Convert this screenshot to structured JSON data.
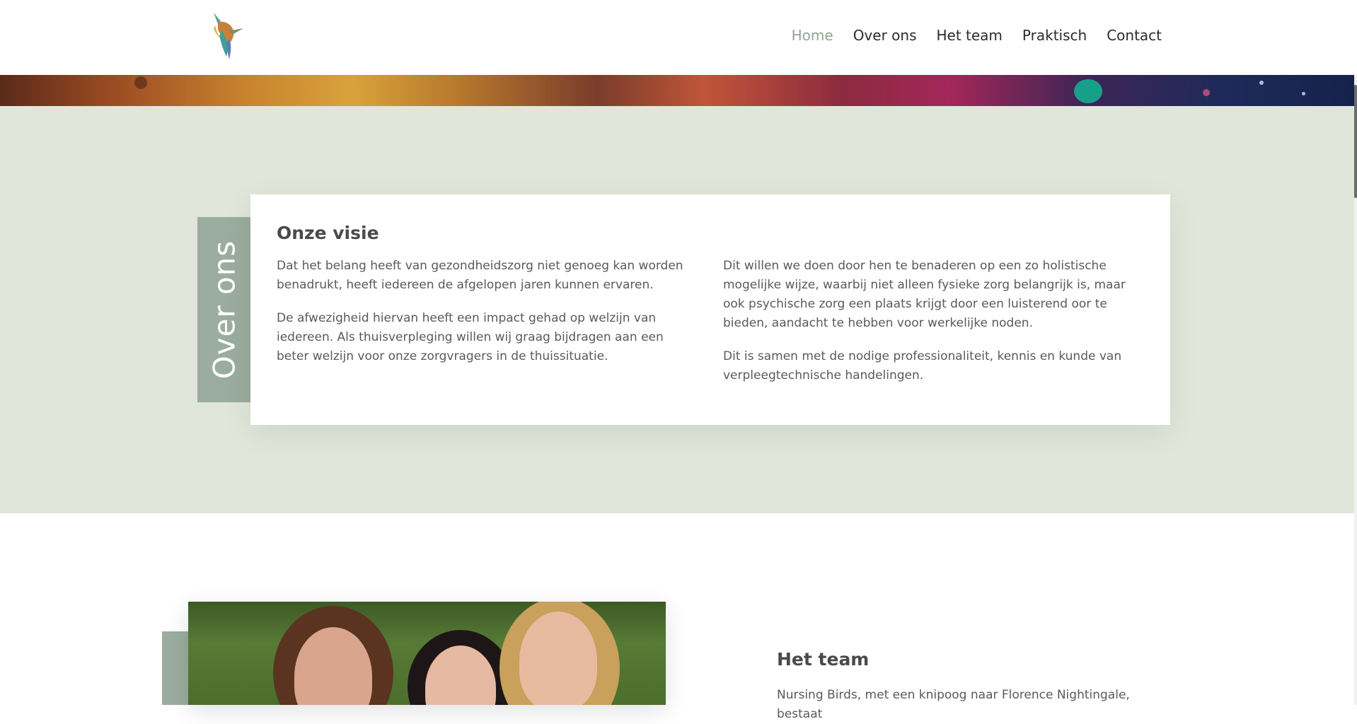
{
  "header": {
    "logo": "hummingbird-logo",
    "nav": [
      {
        "label": "Home",
        "active": true
      },
      {
        "label": "Over ons",
        "active": false
      },
      {
        "label": "Het team",
        "active": false
      },
      {
        "label": "Praktisch",
        "active": false
      },
      {
        "label": "Contact",
        "active": false
      }
    ]
  },
  "about": {
    "side_label": "Over ons",
    "title": "Onze visie",
    "left_paragraphs": [
      "Dat het belang heeft van gezondheidszorg niet genoeg kan worden benadrukt, heeft iedereen de afgelopen jaren kunnen ervaren.",
      "De afwezigheid hiervan heeft een impact gehad op welzijn van iedereen. Als thuisverpleging willen wij graag bijdragen aan een beter welzijn voor onze zorgvragers in de thuissituatie."
    ],
    "right_paragraphs": [
      "Dit willen we doen door hen te benaderen op een zo holistische mogelijke wijze, waarbij niet alleen fysieke zorg belangrijk is, maar ook psychische zorg een plaats krijgt door een luisterend oor te bieden, aandacht te hebben voor werkelijke noden.",
      "Dit is samen met de nodige professionaliteit, kennis en kunde van verpleegtechnische handelingen."
    ]
  },
  "team": {
    "title": "Het team",
    "intro": "Nursing Birds, met een knipoog naar Florence Nightingale, bestaat"
  },
  "colors": {
    "accent": "#9bad9f",
    "nav_active": "#8fa596",
    "section_bg": "#e1e6da"
  }
}
